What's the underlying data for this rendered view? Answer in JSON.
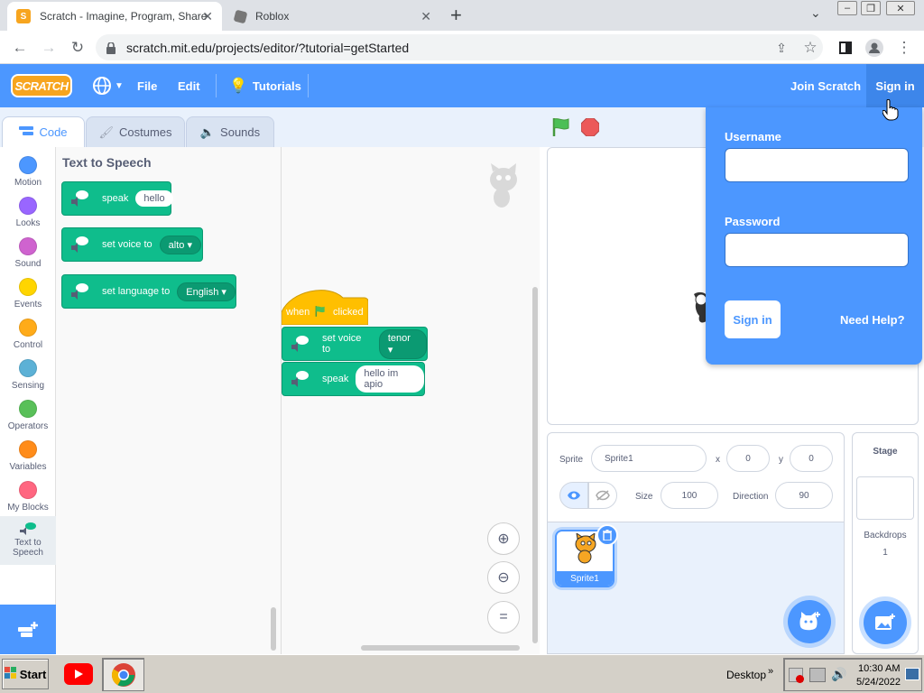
{
  "browser": {
    "tabs": [
      {
        "title": "Scratch - Imagine, Program, Share",
        "active": true
      },
      {
        "title": "Roblox",
        "active": false
      }
    ],
    "url": "scratch.mit.edu/projects/editor/?tutorial=getStarted"
  },
  "menubar": {
    "logo": "SCRATCH",
    "file": "File",
    "edit": "Edit",
    "tutorials": "Tutorials",
    "join": "Join Scratch",
    "signin": "Sign in"
  },
  "editor_tabs": {
    "code": "Code",
    "costumes": "Costumes",
    "sounds": "Sounds"
  },
  "categories": [
    {
      "label": "Motion",
      "color": "#4c97ff"
    },
    {
      "label": "Looks",
      "color": "#9966ff"
    },
    {
      "label": "Sound",
      "color": "#cf63cf"
    },
    {
      "label": "Events",
      "color": "#ffd500"
    },
    {
      "label": "Control",
      "color": "#ffab19"
    },
    {
      "label": "Sensing",
      "color": "#5cb1d6"
    },
    {
      "label": "Operators",
      "color": "#59c059"
    },
    {
      "label": "Variables",
      "color": "#ff8c1a"
    },
    {
      "label": "My Blocks",
      "color": "#ff6680"
    },
    {
      "label": "Text to Speech",
      "color": "#0fbd8c"
    }
  ],
  "palette": {
    "heading": "Text to Speech",
    "speak": {
      "label": "speak",
      "value": "hello"
    },
    "voice": {
      "label": "set voice to",
      "value": "alto"
    },
    "language": {
      "label": "set language to",
      "value": "English"
    }
  },
  "script": {
    "hat": {
      "when": "when",
      "clicked": "clicked"
    },
    "voice": {
      "label": "set voice to",
      "value": "tenor"
    },
    "speak": {
      "label": "speak",
      "value": "hello im apio"
    }
  },
  "sprite_info": {
    "sprite_label": "Sprite",
    "sprite_name": "Sprite1",
    "x_label": "x",
    "x": "0",
    "y_label": "y",
    "y": "0",
    "size_label": "Size",
    "size": "100",
    "direction_label": "Direction",
    "direction": "90"
  },
  "sprite_list": {
    "items": [
      {
        "name": "Sprite1"
      }
    ]
  },
  "stage_panel": {
    "title": "Stage",
    "backdrops_label": "Backdrops",
    "backdrops_count": "1"
  },
  "signin_dropdown": {
    "username_label": "Username",
    "password_label": "Password",
    "submit": "Sign in",
    "help": "Need Help?"
  },
  "taskbar": {
    "start": "Start",
    "desktop": "Desktop",
    "time": "10:30 AM",
    "date": "5/24/2022"
  }
}
